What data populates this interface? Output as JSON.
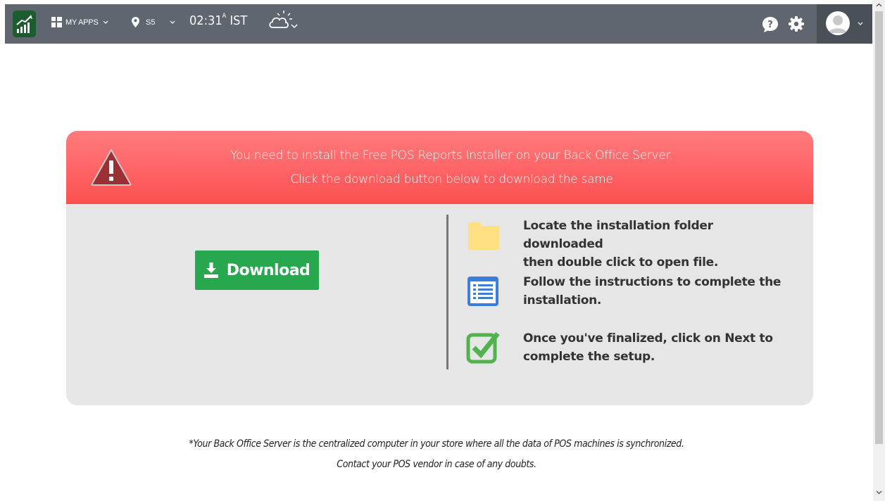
{
  "topbar": {
    "apps_label": "MY APPS",
    "store_label": "S5",
    "time": "02:31",
    "time_suffix": "A",
    "timezone": "IST"
  },
  "alert": {
    "line1": "You need to install the Free POS Reports Installer on your Back Office Server.",
    "line2": "Click the download button below to download the same"
  },
  "download_label": "Download",
  "steps": [
    {
      "icon": "folder-icon",
      "line1": "Locate the installation folder downloaded",
      "line2": "then double click to open file."
    },
    {
      "icon": "list-icon",
      "line1": "Follow the instructions to complete the",
      "line2": "installation."
    },
    {
      "icon": "checkbox-icon",
      "line1": "Once you've finalized, click on Next to",
      "line2": "complete the setup."
    }
  ],
  "footnote": {
    "line1": "*Your Back Office Server is the centralized computer in your store where all the data of POS machines is synchronized.",
    "line2": "Contact your POS vendor in case of any doubts."
  },
  "colors": {
    "topbar": "#5f6670",
    "alert": "#ff6466",
    "download_button": "#27a84f",
    "folder": "#ffe083",
    "list": "#3b7dd8",
    "check": "#52b34e"
  }
}
